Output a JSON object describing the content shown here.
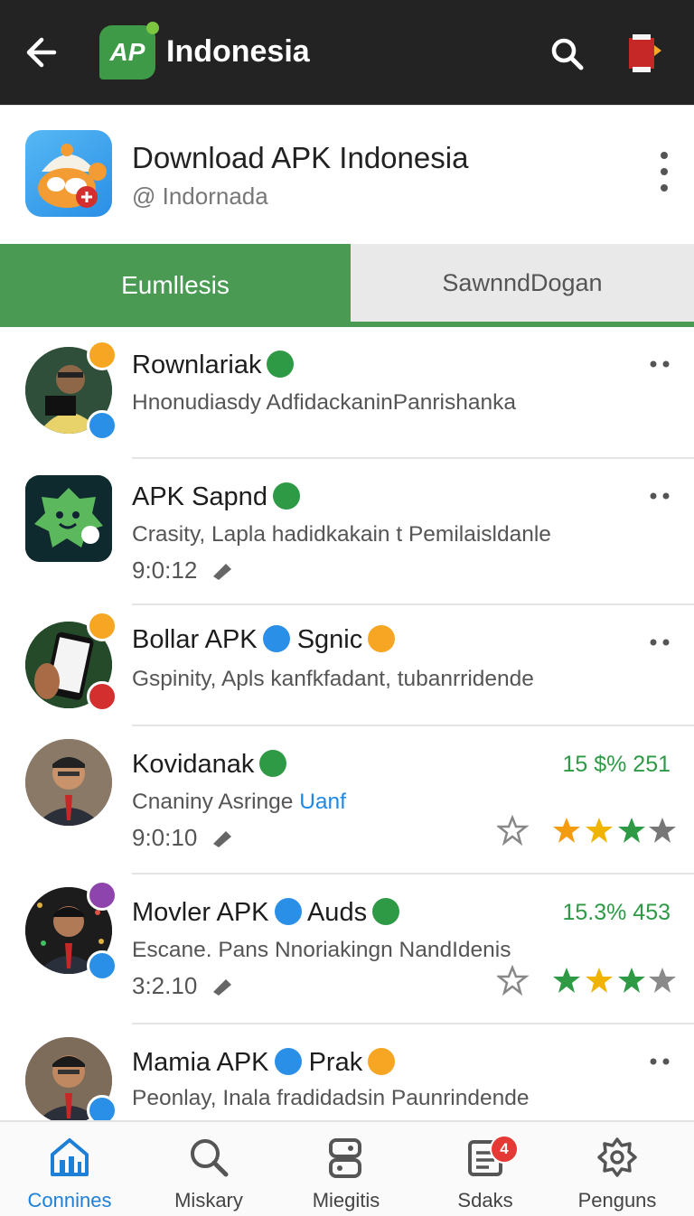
{
  "topbar": {
    "title": "Indonesia",
    "logo_text": "AP",
    "icons": [
      "back-arrow-icon",
      "search-icon",
      "book-icon"
    ]
  },
  "header": {
    "name": "Download APK Indonesia",
    "handle": "@  Indornada"
  },
  "tabs": [
    {
      "label": "Eumllesis",
      "active": true
    },
    {
      "label": "SawnndDogan",
      "active": false
    }
  ],
  "list": [
    {
      "title": "Rownlariak",
      "subtitle": "Hnonudiasdy AdfidackaninPanrishanka"
    },
    {
      "title": "APK Sapnd",
      "subtitle": "Crasity, Lapla hadidkakain t Pemilaisldanle",
      "time": "9:0:12"
    },
    {
      "title": "Bollar APK",
      "title2": "Sgnic",
      "subtitle": "Gspinity, Apls kanfkfadant, tubanrridende"
    },
    {
      "title": "Kovidanak",
      "subtitle": "Cnaniny Asringe",
      "subtitle_link": "Uanf",
      "time": "9:0:10",
      "price": "15 $% 251",
      "rating": 3.5
    },
    {
      "title": "Movler APK",
      "title2": "Auds",
      "subtitle": "Escane. Pans Nnoriakingn NandIdenis",
      "time": "3:2.10",
      "price": "15.3% 453",
      "rating": 3
    },
    {
      "title": "Mamia APK",
      "title2": "Prak",
      "subtitle": "Peonlay, Inala fradidadsin Paunrindende"
    }
  ],
  "bottom_nav": [
    {
      "label": "Connines",
      "icon": "home-icon",
      "active": true
    },
    {
      "label": "Miskary",
      "icon": "search-icon",
      "active": false
    },
    {
      "label": "Miegitis",
      "icon": "apps-icon",
      "active": false
    },
    {
      "label": "Sdaks",
      "icon": "document-icon",
      "active": false,
      "badge": "4"
    },
    {
      "label": "Penguns",
      "icon": "settings-icon",
      "active": false
    }
  ],
  "colors": {
    "accent_green": "#4a9a54",
    "verified_blue": "#2a8fe6",
    "active_nav": "#1e7fd6",
    "price_green": "#2e9a46"
  }
}
